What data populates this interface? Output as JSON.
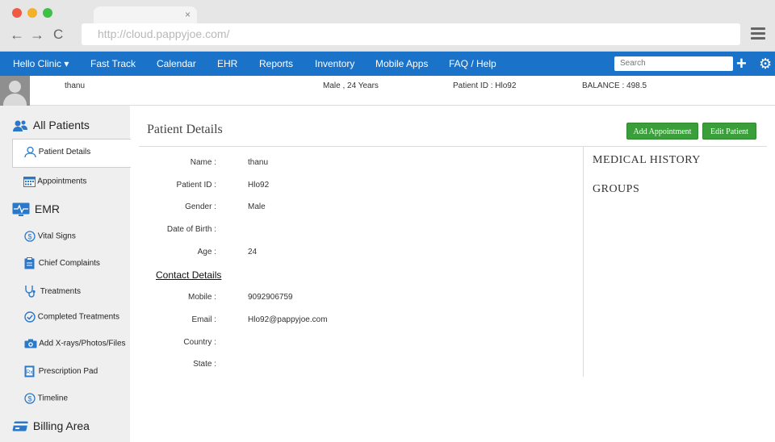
{
  "browser": {
    "url": "http://cloud.pappyjoe.com/",
    "tab_close": "×",
    "back": "←",
    "forward": "→",
    "reload": "C"
  },
  "topnav": {
    "clinic": "Hello Clinic ▾",
    "items": [
      "Fast Track",
      "Calendar",
      "EHR",
      "Reports",
      "Inventory",
      "Mobile Apps",
      "FAQ / Help"
    ],
    "search_placeholder": "Search",
    "plus": "+",
    "gear": "⚙"
  },
  "patient_bar": {
    "name": "thanu",
    "gender_age": "Male , 24 Years",
    "patient_id": "Patient ID : Hlo92",
    "balance": "BALANCE :  498.5"
  },
  "sidebar": {
    "all_patients": "All Patients",
    "patient_details": "Patient Details",
    "appointments": "Appointments",
    "emr": "EMR",
    "vital_signs": "Vital Signs",
    "chief_complaints": "Chief Complaints",
    "treatments": "Treatments",
    "completed_treatments": "Completed Treatments",
    "add_files": "Add X-rays/Photos/Files",
    "prescription_pad": "Prescription Pad",
    "timeline": "Timeline",
    "billing_area": "Billing Area"
  },
  "main": {
    "title": "Patient Details",
    "add_appointment": "Add Appointment",
    "edit_patient": "Edit Patient",
    "fields": {
      "name_label": "Name :",
      "name_value": "thanu",
      "pid_label": "Patient ID :",
      "pid_value": "Hlo92",
      "gender_label": "Gender :",
      "gender_value": "Male",
      "dob_label": "Date of Birth :",
      "age_label": "Age :",
      "age_value": "24"
    },
    "contact_heading": "Contact Details",
    "contact": {
      "mobile_label": "Mobile :",
      "mobile_value": "9092906759",
      "email_label": "Email :",
      "email_value": "Hlo92@pappyjoe.com",
      "country_label": "Country :",
      "state_label": "State :"
    },
    "medical_history": "MEDICAL HISTORY",
    "groups": "GROUPS"
  },
  "colors": {
    "nav_blue": "#1a73c9",
    "button_green": "#3a9f3a",
    "sidebar_bg": "#efefef"
  }
}
